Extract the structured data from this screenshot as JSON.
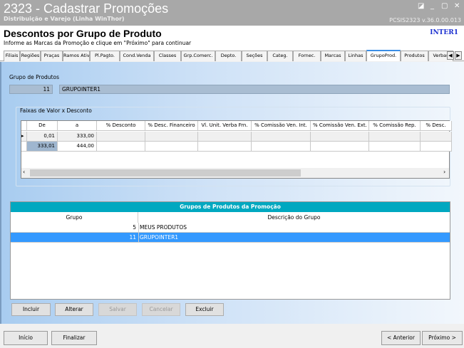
{
  "window": {
    "title": "2323 - Cadastrar Promoções",
    "subtitle": "Distribuição e Varejo (Linha WinThor)",
    "version": "PCSIS2323  v.36.0.00.013",
    "controls": [
      "◪",
      "_",
      "▢",
      "✕"
    ]
  },
  "header": {
    "title": "Descontos por Grupo de Produto",
    "instruction": "Informe as Marcas da Promoção e clique em \"Próximo\" para continuar",
    "user": "INTER1"
  },
  "tabs": [
    "Filiais",
    "Regiões",
    "Praças",
    "Ramos Ativ.",
    "Pl.Pagto.",
    "Cond.Venda",
    "Classes",
    "Grp.Comerc.",
    "Depto.",
    "Seções",
    "Categ.",
    "Fornec.",
    "Marcas",
    "Linhas",
    "GrupoProd.",
    "Produtos",
    "Verbas"
  ],
  "active_tab": "GrupoProd.",
  "grupo": {
    "label": "Grupo de Produtos",
    "code": "11",
    "name": "GRUPOINTER1"
  },
  "faixas": {
    "label": "Faixas de Valor x Desconto",
    "columns": [
      "De",
      "a",
      "% Desconto",
      "% Desc. Financeiro",
      "Vl. Unit. Verba Frn.",
      "% Comissão Ven. Int.",
      "% Comissão Ven. Ext.",
      "% Comissão Rep.",
      "% Desc."
    ],
    "rows": [
      [
        "0,01",
        "333,00",
        "",
        "",
        "",
        "",
        "",
        "",
        ""
      ],
      [
        "333,01",
        "444,00",
        "",
        "",
        "",
        "",
        "",
        "",
        ""
      ]
    ]
  },
  "grupos_table": {
    "title": "Grupos de Produtos da Promoção",
    "columns": [
      "Grupo",
      "Descrição do Grupo"
    ],
    "rows": [
      [
        "5",
        "MEUS PRODUTOS"
      ],
      [
        "11",
        "GRUPOINTER1"
      ]
    ],
    "selected_index": 1
  },
  "buttons": {
    "incluir": "Incluir",
    "alterar": "Alterar",
    "salvar": "Salvar",
    "cancelar": "Cancelar",
    "excluir": "Excluir"
  },
  "footer": {
    "inicio": "Início",
    "finalizar": "Finalizar",
    "anterior": "< Anterior",
    "proximo": "Próximo >"
  },
  "colors": {
    "accent": "#00a8c0",
    "selection": "#3399ff",
    "user": "#1a2fd0"
  }
}
